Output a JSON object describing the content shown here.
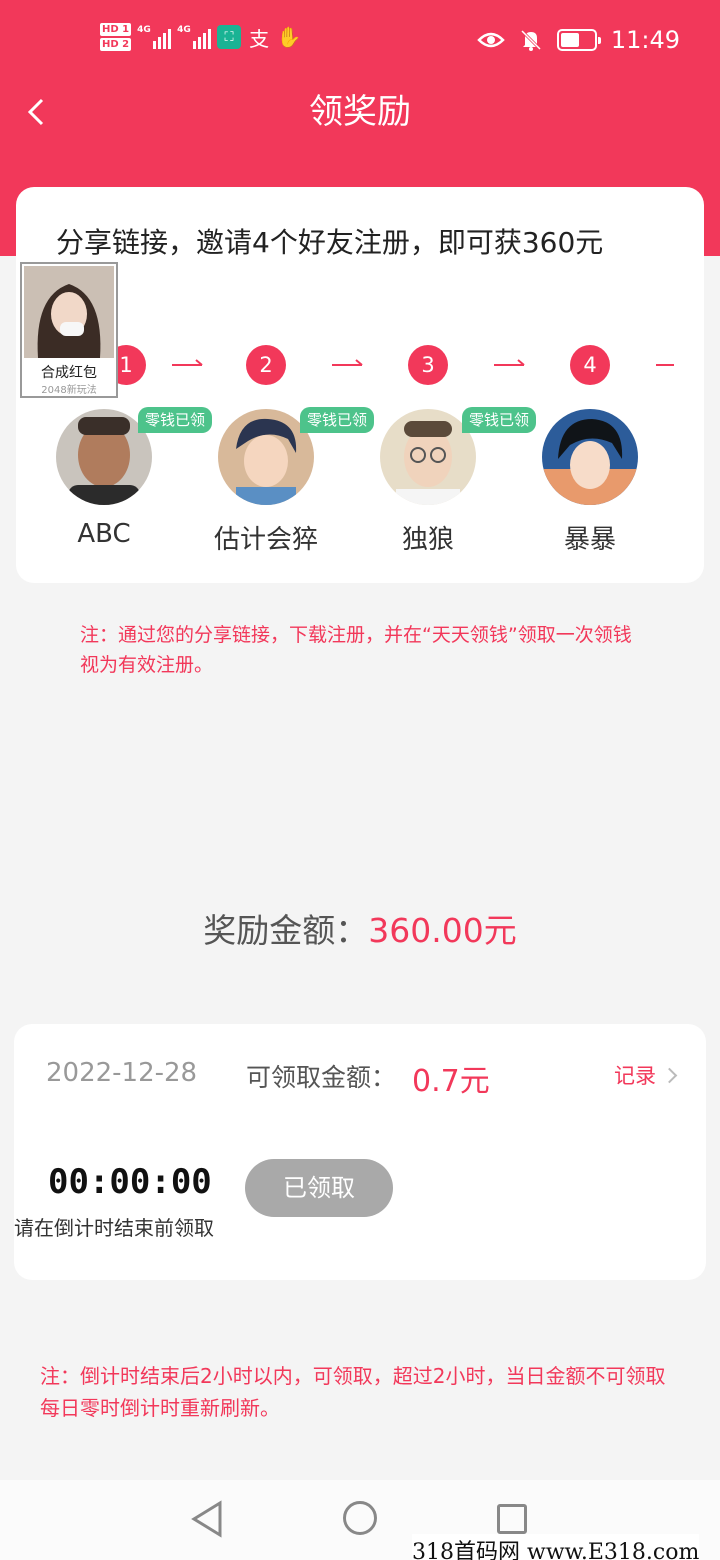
{
  "status_bar": {
    "time": "11:49",
    "hd1": "HD 1",
    "hd2": "HD 2",
    "net1": "4G",
    "net2": "4G",
    "icons": [
      "hd-icon",
      "signal-icon",
      "signal-icon",
      "app-icon",
      "alipay-icon",
      "hand-icon",
      "eye-icon",
      "bell-off-icon",
      "battery-icon"
    ]
  },
  "header": {
    "title": "领奖励",
    "back_icon": "chevron-left-icon"
  },
  "invite": {
    "headline": "分享链接，邀请4个好友注册，即可获360元",
    "steps": [
      "1",
      "2",
      "3",
      "4"
    ],
    "claimed_badge": "零钱已领",
    "friends": [
      {
        "name": "ABC",
        "claimed": true
      },
      {
        "name": "估计会猝",
        "claimed": true
      },
      {
        "name": "独狼",
        "claimed": true
      },
      {
        "name": "暴暴",
        "claimed": false
      }
    ]
  },
  "float_ad": {
    "title": "合成红包",
    "subtitle": "2048新玩法"
  },
  "note1": "注：通过您的分享链接，下载注册，并在“天天领钱”领取一次领钱视为有效注册。",
  "reward": {
    "label": "奖励金额：",
    "amount": "360.00元"
  },
  "daily": {
    "date": "2022-12-28",
    "claim_label": "可领取金额：",
    "claim_amount": "0.7元",
    "record_label": "记录",
    "timer": "00:00:00",
    "timer_note": "请在倒计时结束前领取",
    "button_label": "已领取"
  },
  "note2": "注：倒计时结束后2小时以内，可领取，超过2小时，当日金额不可领取 每日零时倒计时重新刷新。",
  "watermark": "318首码网 www.E318.com",
  "colors": {
    "brand": "#f2385a",
    "badge": "#4dc38b",
    "disabled": "#a9a9a9"
  }
}
